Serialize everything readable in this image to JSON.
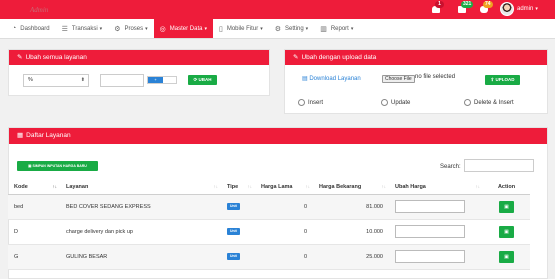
{
  "topbar": {
    "brand": "Admin",
    "badges": [
      {
        "icon": "bell-icon",
        "count": "1",
        "color": "#ee1c3a"
      },
      {
        "icon": "mail-icon",
        "count": "321",
        "color": "#19ab45"
      },
      {
        "icon": "chat-icon",
        "count": "74",
        "color": "#f0a020"
      }
    ],
    "user_name": "admin"
  },
  "nav": {
    "items": [
      {
        "label": "Dashboard",
        "icon": "dashboard-icon",
        "caret": false
      },
      {
        "label": "Transaksi",
        "icon": "list-icon",
        "caret": true
      },
      {
        "label": "Proses",
        "icon": "gears-icon",
        "caret": true
      },
      {
        "label": "Master Data",
        "icon": "target-icon",
        "caret": true,
        "active": true
      },
      {
        "label": "Mobile Fitur",
        "icon": "mobile-icon",
        "caret": true
      },
      {
        "label": "Setting",
        "icon": "gears-icon",
        "caret": true
      },
      {
        "label": "Report",
        "icon": "bar-chart-icon",
        "caret": true
      }
    ]
  },
  "ubah_semua": {
    "title": "Ubah semua layanan",
    "select_value": "%",
    "toggle_label": "+",
    "button_label": "UBAH"
  },
  "upload_panel": {
    "title": "Ubah dengan upload data",
    "download_link": "Download Layanan",
    "choose_file_label": "Choose File",
    "file_status": "no file selected",
    "upload_button": "UPLOAD",
    "radios": [
      "Insert",
      "Update",
      "Delete & Insert"
    ]
  },
  "daftar": {
    "title": "Daftar Layanan",
    "save_all_button": "SIMPAN INPUTAN HARGA BARU",
    "search_label": "Search:",
    "columns": [
      "Kode",
      "Layanan",
      "Tipe",
      "Harga Lama",
      "Harga Bekarang",
      "Ubah Harga",
      "Action"
    ],
    "rows": [
      {
        "kode": "bed",
        "layanan": "BED COVER SEDANG EXPRESS",
        "tipe": "Unit",
        "harga_lama": "0",
        "harga_baru": "81.000"
      },
      {
        "kode": "D",
        "layanan": "charge delivery dan pick up",
        "tipe": "Unit",
        "harga_lama": "0",
        "harga_baru": "10.000"
      },
      {
        "kode": "G",
        "layanan": "GULING BESAR",
        "tipe": "Unit",
        "harga_lama": "0",
        "harga_baru": "25.000"
      }
    ]
  },
  "colors": {
    "accent": "#ee1c3a",
    "green": "#19ab45",
    "blue": "#2a82d6"
  }
}
